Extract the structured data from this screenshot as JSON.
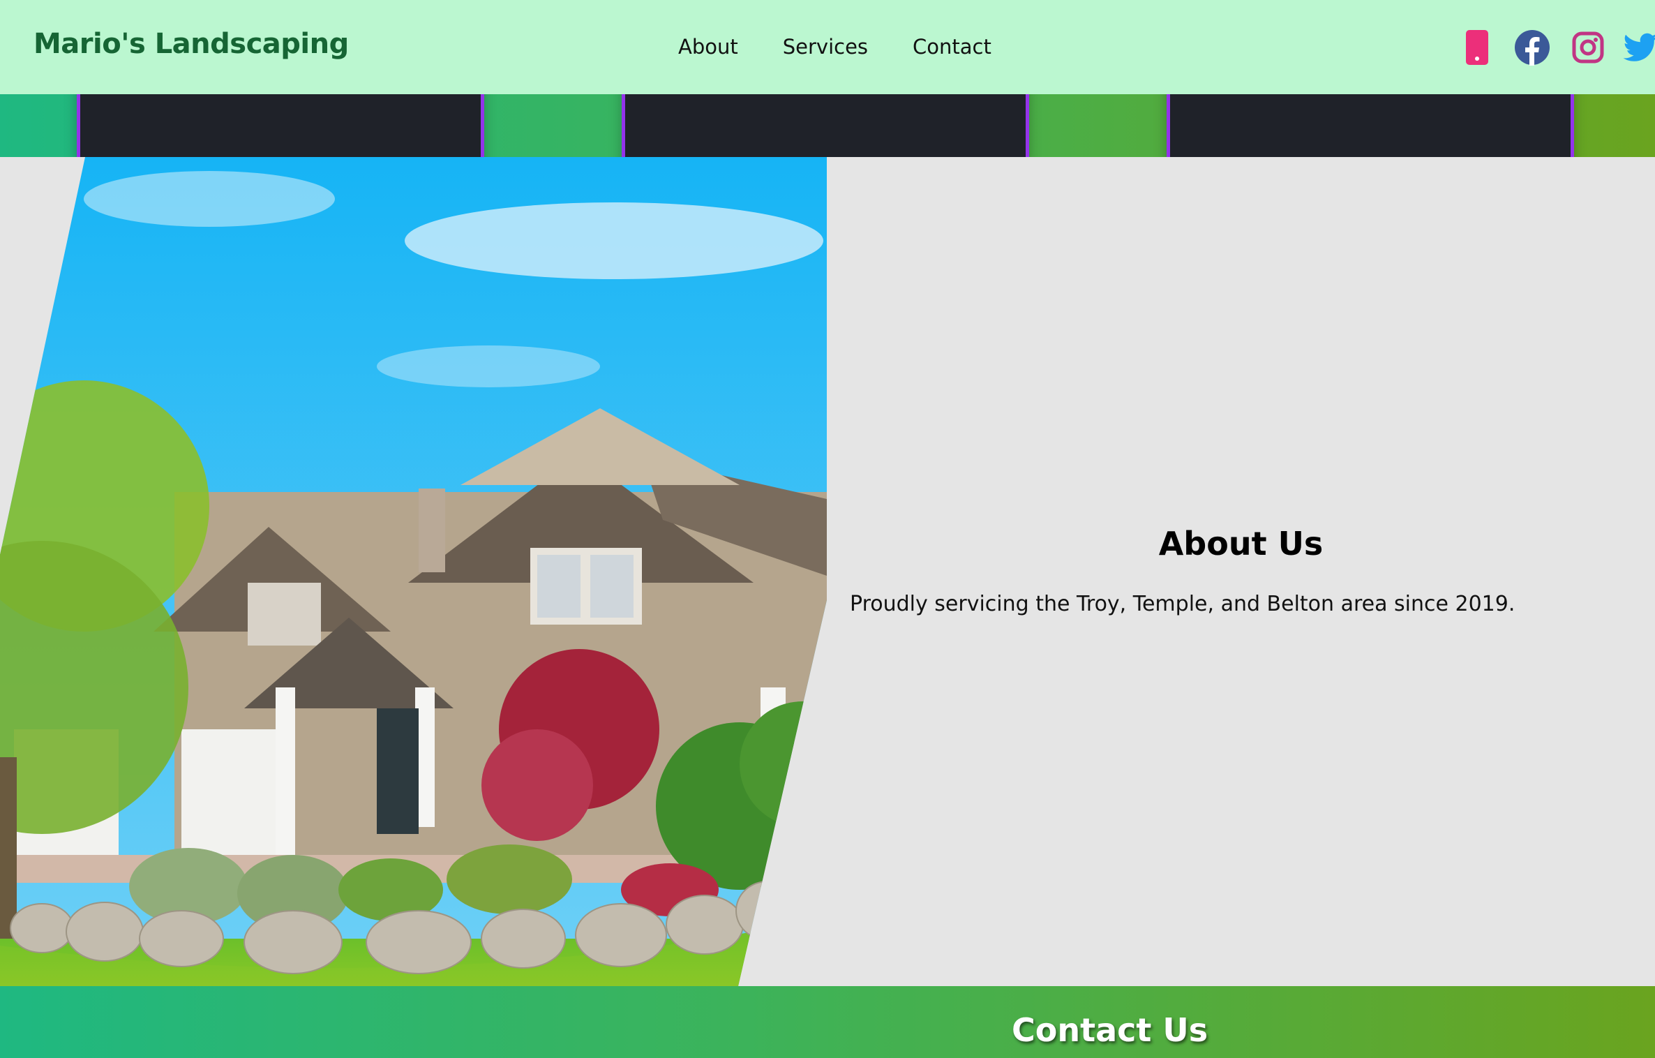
{
  "header": {
    "brand": "Mario's Landscaping",
    "nav": [
      "About",
      "Services",
      "Contact"
    ],
    "social_icons": [
      "phone-icon",
      "facebook-icon",
      "instagram-icon",
      "twitter-icon"
    ]
  },
  "about": {
    "title": "About Us",
    "text": "Proudly servicing the Troy, Temple, and Belton area since 2019."
  },
  "contact": {
    "title": "Contact Us"
  },
  "colors": {
    "navbar": "#bbf7d0",
    "brand": "#166534",
    "gradient_start": "#1fb881",
    "gradient_end": "#6aa41f",
    "card_border": "#9333ea",
    "card_fill": "#1f2229",
    "phone": "#ec2f7a",
    "facebook": "#3b5998",
    "instagram": "#c13584",
    "twitter": "#1da1f2"
  }
}
